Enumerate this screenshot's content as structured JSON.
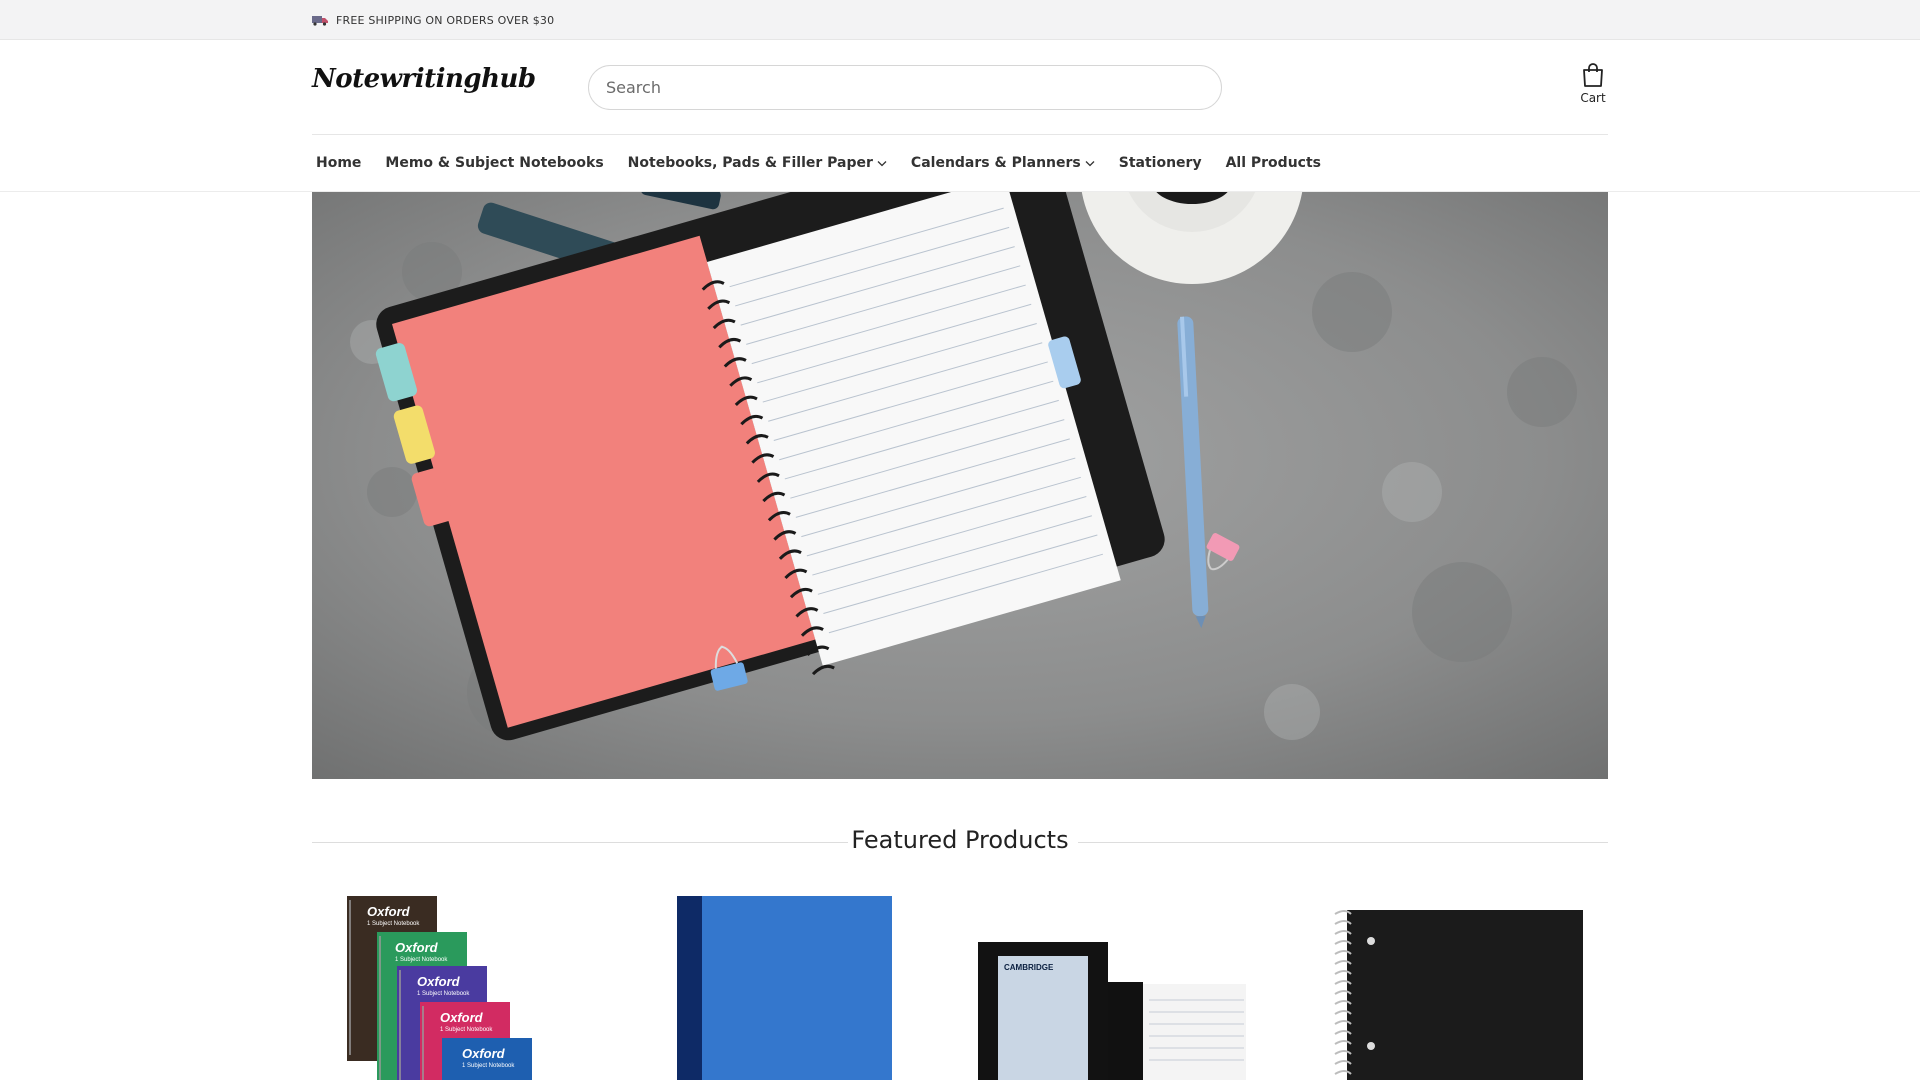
{
  "topbar": {
    "shipping_text": "FREE SHIPPING ON ORDERS OVER $30",
    "icon": "truck-icon"
  },
  "header": {
    "logo_text": "Notewritinghub",
    "search_placeholder": "Search",
    "cart_label": "Cart",
    "cart_icon": "shopping-bag-icon"
  },
  "nav": {
    "items": [
      {
        "label": "Home",
        "has_dropdown": false
      },
      {
        "label": "Memo & Subject Notebooks",
        "has_dropdown": false
      },
      {
        "label": "Notebooks, Pads & Filler Paper",
        "has_dropdown": true
      },
      {
        "label": "Calendars & Planners",
        "has_dropdown": true
      },
      {
        "label": "Stationery",
        "has_dropdown": false
      },
      {
        "label": "All Products",
        "has_dropdown": false
      }
    ]
  },
  "hero": {
    "image": "notebook-desk-photo"
  },
  "featured": {
    "title": "Featured Products",
    "products": [
      {
        "image": "oxford-notebooks-image",
        "brand_text": "Oxford",
        "sub_text": "1 Subject Notebook"
      },
      {
        "image": "blue-binder-image"
      },
      {
        "image": "cambridge-notebook-image",
        "brand_text": "CAMBRIDGE"
      },
      {
        "image": "black-spiral-notebook-image"
      }
    ]
  },
  "colors": {
    "topbar_bg": "#f3f3f4",
    "hero_bg": "#8f9090",
    "notebook_cover": "#f2817c",
    "accent_blue": "#7fb0e0"
  }
}
